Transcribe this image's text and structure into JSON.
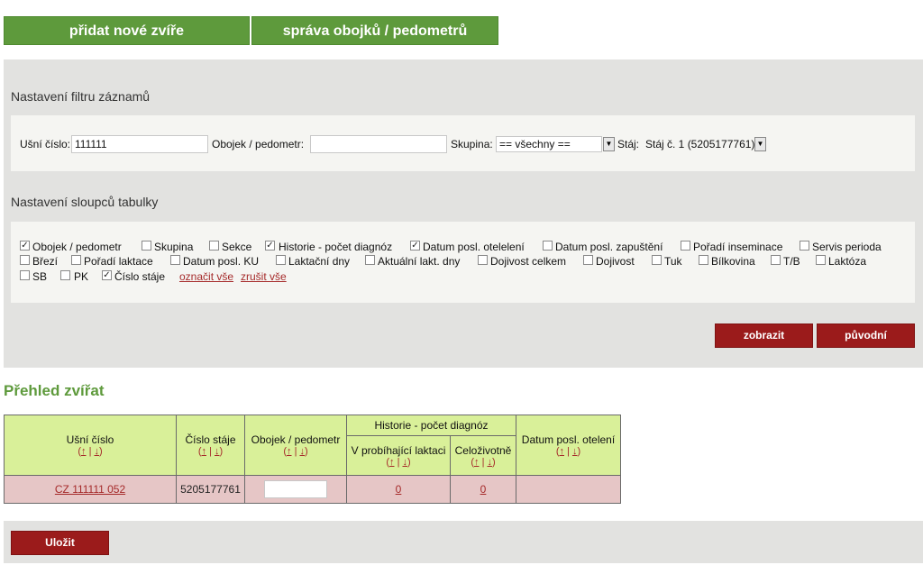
{
  "top_buttons": {
    "add_animal": "přidat nové zvíře",
    "collar_mgmt": "správa obojků / pedometrů"
  },
  "filter": {
    "title": "Nastavení filtru záznamů",
    "ear_label": "Ušní číslo:",
    "ear_value": "111111",
    "collar_label": "Obojek / pedometr:",
    "collar_value": "",
    "group_label": "Skupina:",
    "group_value": "== všechny ==",
    "stable_label": "Stáj:",
    "stable_value": "Stáj č. 1 (5205177761)"
  },
  "columns": {
    "title": "Nastavení sloupců tabulky",
    "items": [
      {
        "label": "Obojek / pedometr",
        "checked": true
      },
      {
        "label": "Skupina",
        "checked": false
      },
      {
        "label": "Sekce",
        "checked": false
      },
      {
        "label": "Historie - počet diagnóz",
        "checked": true
      },
      {
        "label": "Datum posl. otelelení",
        "checked": true
      },
      {
        "label": "Datum posl. zapuštění",
        "checked": false
      },
      {
        "label": "Pořadí inseminace",
        "checked": false
      },
      {
        "label": "Servis perioda",
        "checked": false
      },
      {
        "label": "Březí",
        "checked": false
      },
      {
        "label": "Pořadí laktace",
        "checked": false
      },
      {
        "label": "Datum posl. KU",
        "checked": false
      },
      {
        "label": "Laktační dny",
        "checked": false
      },
      {
        "label": "Aktuální lakt. dny",
        "checked": false
      },
      {
        "label": "Dojivost celkem",
        "checked": false
      },
      {
        "label": "Dojivost",
        "checked": false
      },
      {
        "label": "Tuk",
        "checked": false
      },
      {
        "label": "Bílkovina",
        "checked": false
      },
      {
        "label": "T/B",
        "checked": false
      },
      {
        "label": "Laktóza",
        "checked": false
      },
      {
        "label": "SB",
        "checked": false
      },
      {
        "label": "PK",
        "checked": false
      },
      {
        "label": "Číslo stáje",
        "checked": true
      }
    ],
    "select_all": "označit vše",
    "deselect_all": "zrušit vše"
  },
  "actions": {
    "show": "zobrazit",
    "original": "původní",
    "save": "Uložit"
  },
  "overview": {
    "title": "Přehled zvířat",
    "headers": {
      "ear": "Ušní číslo",
      "stable": "Číslo stáje",
      "collar": "Obojek / pedometr",
      "history": "Historie - počet diagnóz",
      "history_current": "V probíhající laktaci",
      "history_lifetime": "Celoživotně",
      "last_calving": "Datum posl. otelení"
    },
    "sort_up": "↑",
    "sort_sep": "|",
    "sort_down": "↓",
    "rows": [
      {
        "ear": "CZ 111111 052",
        "stable": "5205177761",
        "collar": "",
        "history_current": "0",
        "history_lifetime": "0",
        "last_calving": ""
      }
    ]
  }
}
